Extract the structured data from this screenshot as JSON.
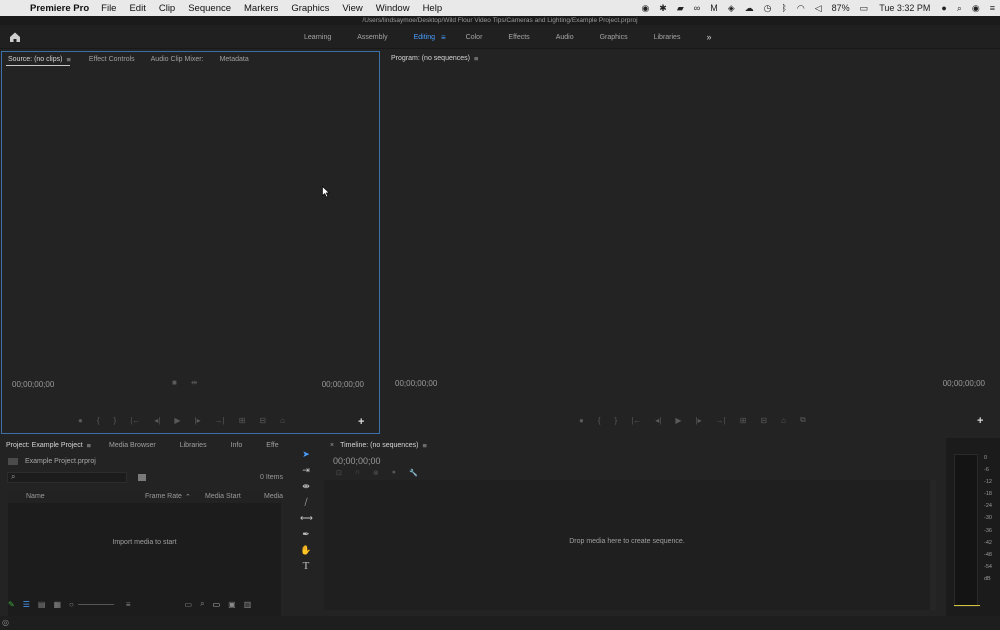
{
  "menubar": {
    "app_name": "Premiere Pro",
    "menus": [
      "File",
      "Edit",
      "Clip",
      "Sequence",
      "Markers",
      "Graphics",
      "View",
      "Window",
      "Help"
    ],
    "battery": "87%",
    "clock": "Tue 3:32 PM"
  },
  "titlebar": {
    "path": "/Users/lindsaymoe/Desktop/Wild Flour Video Tips/Cameras and Lighting/Example Project.prproj"
  },
  "workspace": {
    "tabs": [
      "Learning",
      "Assembly",
      "Editing",
      "Color",
      "Effects",
      "Audio",
      "Graphics",
      "Libraries"
    ],
    "active": "Editing",
    "more": "»"
  },
  "source_panel": {
    "tabs": [
      "Source: (no clips)",
      "Effect Controls",
      "Audio Clip Mixer:",
      "Metadata"
    ],
    "menu_glyph": "≡",
    "timecode_left": "00;00;00;00",
    "timecode_right": "00;00;00;00"
  },
  "program_panel": {
    "title": "Program: (no sequences)",
    "menu_glyph": "≡",
    "timecode_left": "00;00;00;00",
    "timecode_right": "00;00;00;00"
  },
  "project_panel": {
    "tabs": [
      "Project: Example Project",
      "Media Browser",
      "Libraries",
      "Info",
      "Effe"
    ],
    "more": "»",
    "file": "Example Project.prproj",
    "items": "0 Items",
    "columns": [
      "Name",
      "Frame Rate",
      "Media Start",
      "Media"
    ],
    "empty_text": "Import media to start"
  },
  "timeline_panel": {
    "title": "Timeline: (no sequences)",
    "menu_glyph": "≡",
    "close": "×",
    "timecode": "00;00;00;00",
    "drop_text": "Drop media here to create sequence."
  },
  "audio_meter": {
    "scale": [
      "0",
      "-6",
      "-12",
      "-18",
      "-24",
      "-30",
      "-36",
      "-42",
      "-48",
      "-54",
      "dB"
    ]
  }
}
